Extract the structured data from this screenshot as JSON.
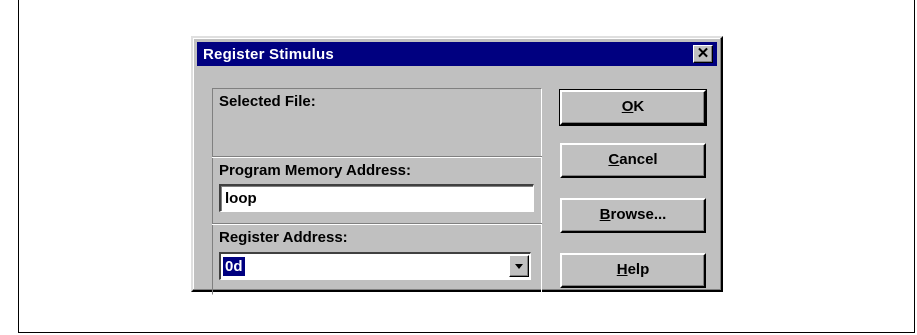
{
  "window": {
    "title": "Register Stimulus",
    "close_glyph": "✕"
  },
  "group": {
    "selected_file_label": "Selected File:",
    "program_memory_label": "Program Memory Address:",
    "program_memory_value": "loop",
    "register_address_label": "Register Address:",
    "register_address_value": "0d"
  },
  "buttons": {
    "ok": {
      "mnemonic": "O",
      "rest": "K"
    },
    "cancel": {
      "mnemonic": "C",
      "rest": "ancel"
    },
    "browse": {
      "mnemonic": "B",
      "rest": "rowse..."
    },
    "help": {
      "mnemonic": "H",
      "rest": "elp"
    }
  },
  "colors": {
    "titlebar": "#000080",
    "face": "#c0c0c0",
    "selection": "#000080"
  },
  "icons": [
    "close-icon",
    "dropdown-arrow-icon"
  ]
}
